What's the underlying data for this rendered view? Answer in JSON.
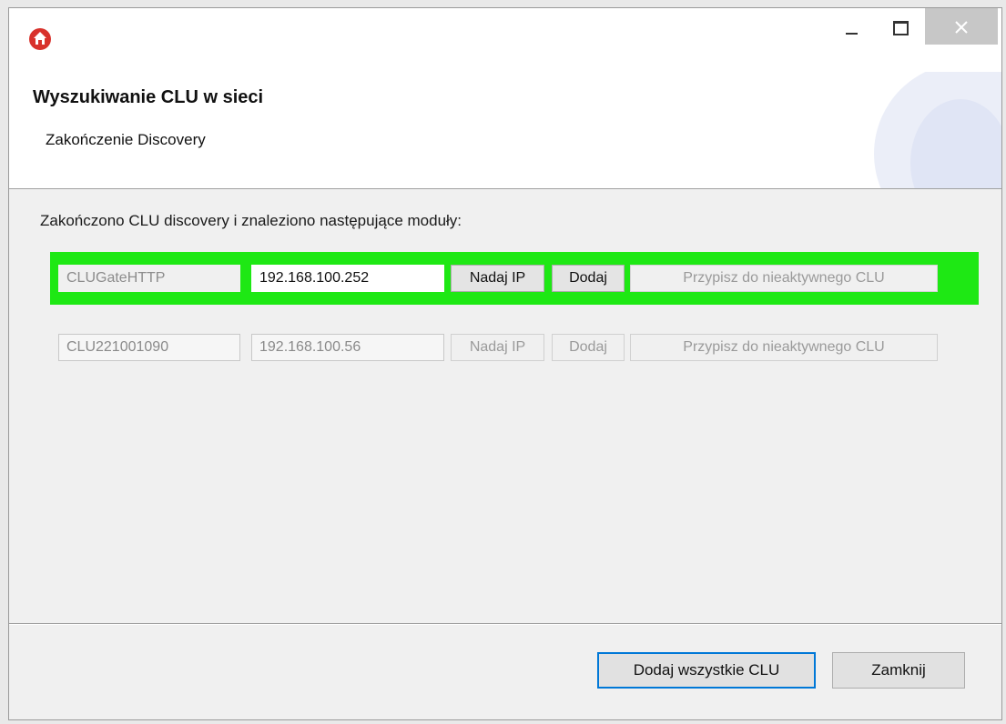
{
  "window": {
    "controls": {
      "minimize": "minimize-icon",
      "maximize": "maximize-icon",
      "close": "close-icon"
    }
  },
  "header": {
    "title": "Wyszukiwanie CLU w sieci",
    "subtitle": "Zakończenie Discovery"
  },
  "content": {
    "label": "Zakończono CLU discovery i znaleziono następujące moduły:",
    "rows": [
      {
        "name": "CLUGateHTTP",
        "ip": "192.168.100.252",
        "assign_ip_label": "Nadaj IP",
        "add_label": "Dodaj",
        "assign_inactive_label": "Przypisz do nieaktywnego CLU",
        "highlight_color": "#1ee814"
      },
      {
        "name": "CLU221001090",
        "ip": "192.168.100.56",
        "assign_ip_label": "Nadaj IP",
        "add_label": "Dodaj",
        "assign_inactive_label": "Przypisz do nieaktywnego CLU"
      }
    ]
  },
  "footer": {
    "add_all_label": "Dodaj wszystkie CLU",
    "close_label": "Zamknij"
  },
  "colors": {
    "accent": "#0078d7",
    "app_icon": "#d8322c",
    "highlight": "#1ee814"
  }
}
